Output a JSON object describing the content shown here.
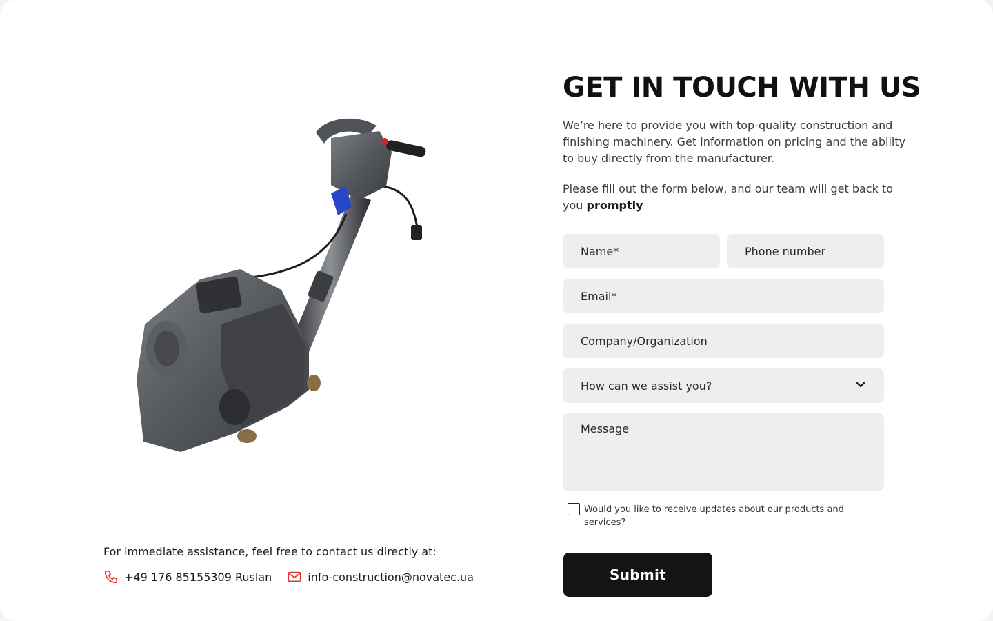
{
  "contact": {
    "intro": "For immediate assistance, feel free to contact us directly at:",
    "phone": "+49 176 85155309 Ruslan",
    "email": "info-construction@novatec.ua",
    "icon_color": "#e0332b"
  },
  "form": {
    "title": "GET IN TOUCH WITH US",
    "description": "We’re here to provide you with top-quality construction and finishing machinery. Get information on pricing and the ability to buy directly from the manufacturer.",
    "note_prefix": "Please fill out the form below, and our team will get back to you ",
    "note_bold": "promptly",
    "fields": {
      "name_placeholder": "Name*",
      "phone_placeholder": "Phone number",
      "email_placeholder": "Email*",
      "company_placeholder": "Company/Organization",
      "assist_select": "How can we assist you?",
      "message_placeholder": "Message"
    },
    "updates_checkbox_label": "Would you like to receive updates about our products and services?",
    "updates_checked": false,
    "submit_label": "Submit"
  },
  "icons": {
    "phone": "phone-icon",
    "email": "mail-icon",
    "select": "chevron-down-icon"
  }
}
